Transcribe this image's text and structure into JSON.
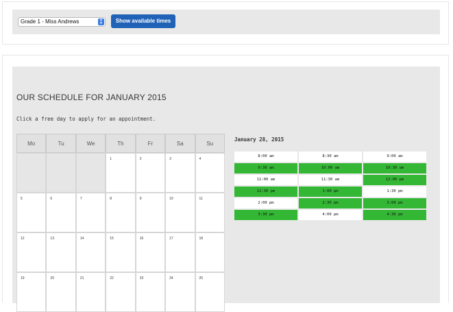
{
  "toolbar": {
    "class_select": "Grade 1 - Miss Andrews",
    "show_button": "Show available times"
  },
  "schedule": {
    "title": "OUR SCHEDULE FOR JANUARY 2015",
    "instruction": "Click a free day to apply for an appointment.",
    "weekdays": [
      "Mo",
      "Tu",
      "We",
      "Th",
      "Fr",
      "Sa",
      "Su"
    ],
    "weeks": [
      [
        "",
        "",
        "",
        "1",
        "2",
        "3",
        "4"
      ],
      [
        "5",
        "6",
        "7",
        "8",
        "9",
        "10",
        "11"
      ],
      [
        "12",
        "13",
        "14",
        "15",
        "16",
        "17",
        "18"
      ],
      [
        "19",
        "20",
        "21",
        "22",
        "23",
        "24",
        "25"
      ]
    ]
  },
  "timeslots": {
    "date": "January 28, 2015",
    "slots": [
      {
        "time": "8:00 am",
        "status": "unavailable"
      },
      {
        "time": "8:30 am",
        "status": "unavailable"
      },
      {
        "time": "9:00 am",
        "status": "unavailable"
      },
      {
        "time": "9:30 am",
        "status": "free"
      },
      {
        "time": "10:00 am",
        "status": "free"
      },
      {
        "time": "10:30 am",
        "status": "free"
      },
      {
        "time": "11:00 am",
        "status": "unavailable"
      },
      {
        "time": "11:30 am",
        "status": "unavailable"
      },
      {
        "time": "12:00 pm",
        "status": "free"
      },
      {
        "time": "12:30 pm",
        "status": "free"
      },
      {
        "time": "1:00 pm",
        "status": "free"
      },
      {
        "time": "1:30 pm",
        "status": "unavailable"
      },
      {
        "time": "2:00 pm",
        "status": "unavailable"
      },
      {
        "time": "2:30 pm",
        "status": "free"
      },
      {
        "time": "3:00 pm",
        "status": "free"
      },
      {
        "time": "3:30 pm",
        "status": "free"
      },
      {
        "time": "4:00 pm",
        "status": "unavailable"
      },
      {
        "time": "4:30 pm",
        "status": "free"
      }
    ]
  },
  "colors": {
    "button_blue": "#1f62b6",
    "free_slot_green": "#34b735",
    "panel_gray": "#e8e8e8"
  }
}
